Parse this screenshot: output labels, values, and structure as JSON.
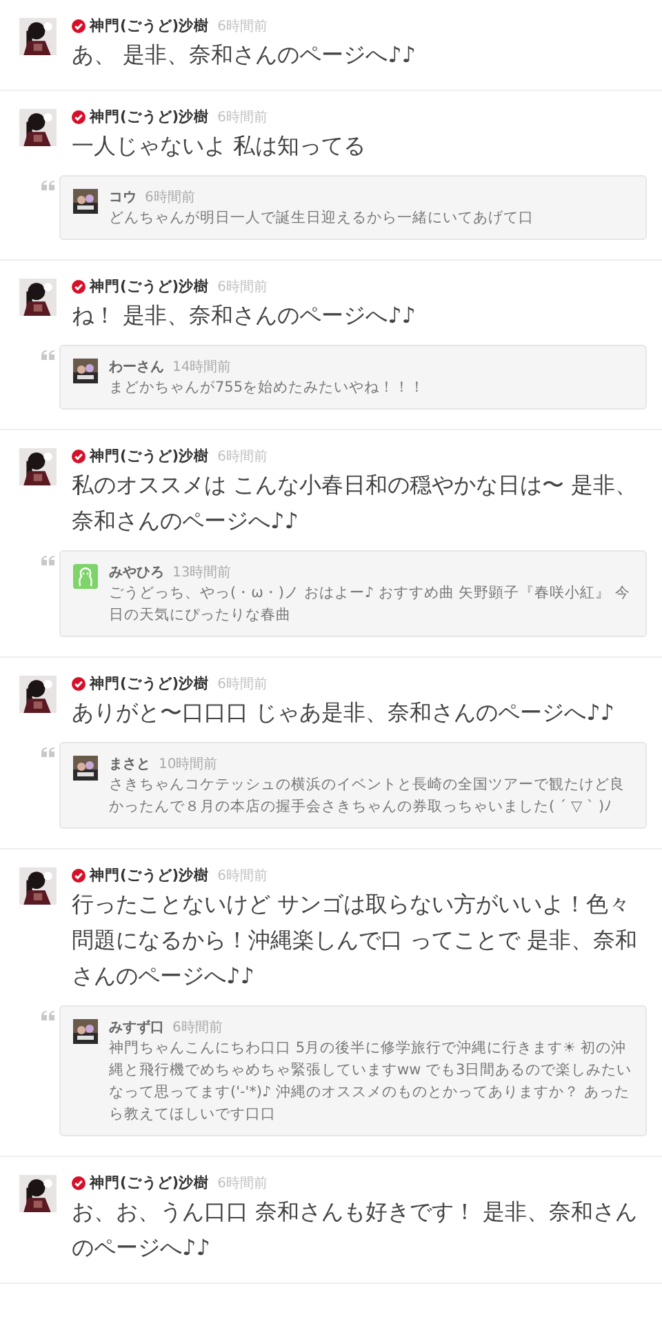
{
  "posts": [
    {
      "author": "神門(ごうど)沙樹",
      "verified": true,
      "time": "6時間前",
      "text": "あ、 是非、奈和さんのページへ♪♪"
    },
    {
      "author": "神門(ごうど)沙樹",
      "verified": true,
      "time": "6時間前",
      "text": "一人じゃないよ 私は知ってる",
      "reply": {
        "name": "コウ",
        "time": "6時間前",
        "text": "どんちゃんが明日一人で誕生日迎えるから一緒にいてあげて口"
      }
    },
    {
      "author": "神門(ごうど)沙樹",
      "verified": true,
      "time": "6時間前",
      "text": "ね！ 是非、奈和さんのページへ♪♪",
      "reply": {
        "name": "わーさん",
        "time": "14時間前",
        "text": "まどかちゃんが755を始めたみたいやね！！！"
      }
    },
    {
      "author": "神門(ごうど)沙樹",
      "verified": true,
      "time": "6時間前",
      "text": "私のオススメは こんな小春日和の穏やかな日は〜 是非、奈和さんのページへ♪♪",
      "reply": {
        "kind": "default",
        "name": "みやひろ",
        "time": "13時間前",
        "text": "ごうどっち、やっ(・ω・)ノ おはよー♪ おすすめ曲 矢野顕子『春咲小紅』 今日の天気にぴったりな春曲"
      }
    },
    {
      "author": "神門(ごうど)沙樹",
      "verified": true,
      "time": "6時間前",
      "text": "ありがと〜口口口 じゃあ是非、奈和さんのページへ♪♪",
      "reply": {
        "name": "まさと",
        "time": "10時間前",
        "text": "さきちゃんコケテッシュの横浜のイベントと長崎の全国ツアーで観たけど良かったんで８月の本店の握手会さきちゃんの券取っちゃいました( ´ ▽ ` )ﾉ"
      }
    },
    {
      "author": "神門(ごうど)沙樹",
      "verified": true,
      "time": "6時間前",
      "text": "行ったことないけど サンゴは取らない方がいいよ！色々問題になるから！沖縄楽しんで口 ってことで 是非、奈和さんのページへ♪♪",
      "reply": {
        "name": "みすず口",
        "time": "6時間前",
        "text": "神門ちゃんこんにちわ口口 5月の後半に修学旅行で沖縄に行きます☀ 初の沖縄と飛行機でめちゃめちゃ緊張していますww でも3日間あるので楽しみたいなって思ってます('-'*)♪ 沖縄のオススメのものとかってありますか？ あったら教えてほしいです口口"
      }
    },
    {
      "author": "神門(ごうど)沙樹",
      "verified": true,
      "time": "6時間前",
      "text": "お、お、うん口口 奈和さんも好きです！ 是非、奈和さんのページへ♪♪"
    }
  ]
}
